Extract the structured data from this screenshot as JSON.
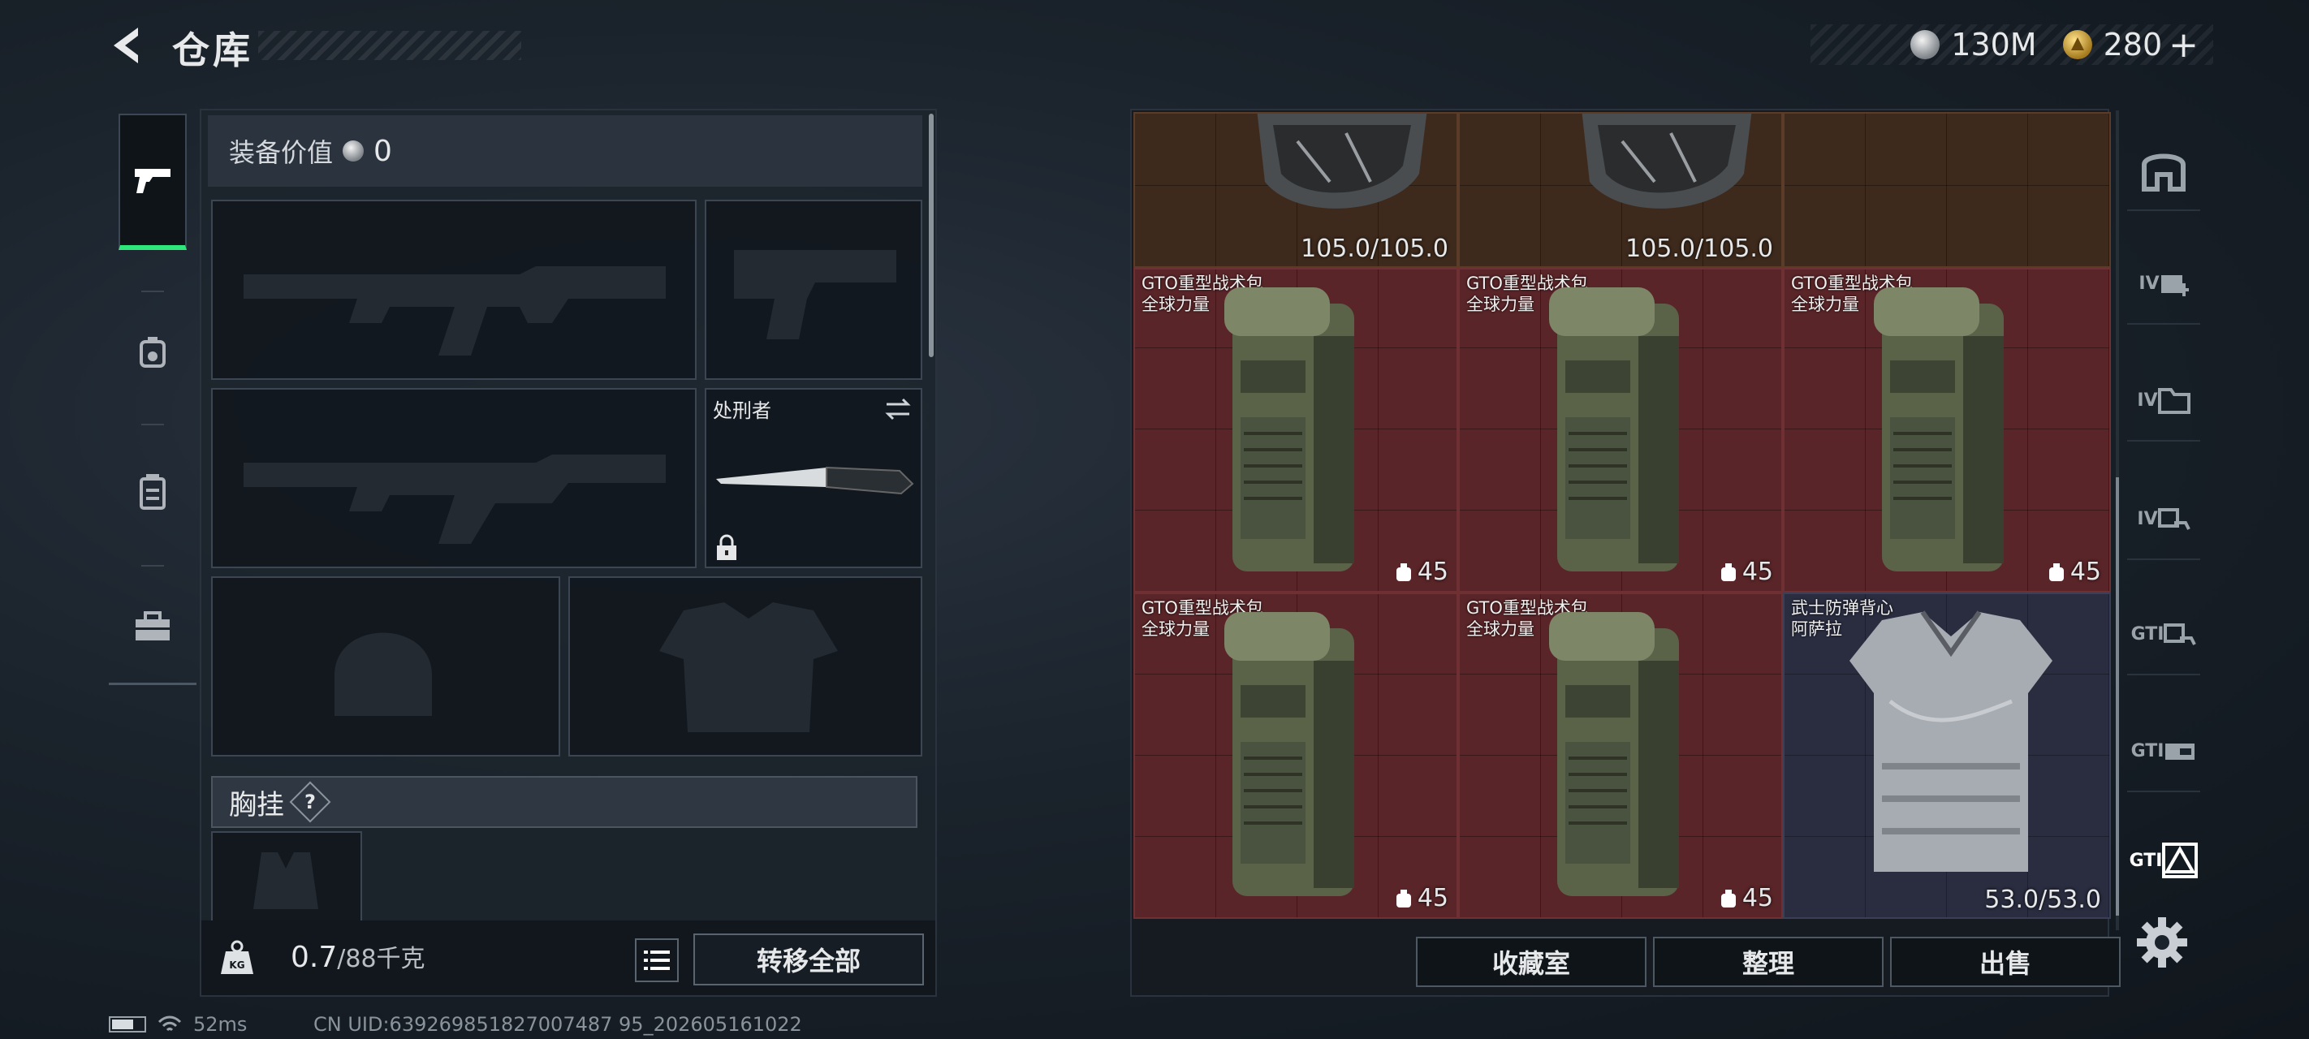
{
  "header": {
    "title": "仓库",
    "currency_silver": "130M",
    "currency_gold": "280",
    "plus_label": "+"
  },
  "left_nav": {
    "items": [
      {
        "name": "weapons-tab",
        "icon": "pistol-icon",
        "active": true
      },
      {
        "name": "gear-tab",
        "icon": "helmet-bag-icon",
        "active": false
      },
      {
        "name": "backpack-tab",
        "icon": "backpack-icon",
        "active": false
      },
      {
        "name": "toolbox-tab",
        "icon": "toolbox-icon",
        "active": false
      }
    ]
  },
  "loadout": {
    "equipment_value_label": "装备价值",
    "equipment_value": "0",
    "knife_name": "处刑者",
    "chest_rig_label": "胸挂",
    "chest_rig_hint": "?",
    "weight_current": "0.7",
    "weight_max": "/88千克",
    "transfer_all_label": "转移全部"
  },
  "storage": {
    "top_items": [
      {
        "durability": "105.0/105.0"
      },
      {
        "durability": "105.0/105.0"
      }
    ],
    "items": [
      {
        "name": "GTO重型战术包",
        "brand": "全球力量",
        "capacity": "45"
      },
      {
        "name": "GTO重型战术包",
        "brand": "全球力量",
        "capacity": "45"
      },
      {
        "name": "GTO重型战术包",
        "brand": "全球力量",
        "capacity": "45"
      },
      {
        "name": "GTO重型战术包",
        "brand": "全球力量",
        "capacity": "45"
      },
      {
        "name": "GTO重型战术包",
        "brand": "全球力量",
        "capacity": "45"
      },
      {
        "name": "武士防弹背心",
        "brand": "阿萨拉",
        "durability": "53.0/53.0"
      }
    ],
    "buttons": {
      "collection": "收藏室",
      "sort": "整理",
      "sell": "出售"
    }
  },
  "right_rail": {
    "items": [
      "",
      "IV",
      "IV",
      "IV",
      "GTI",
      "GTI",
      "GTI"
    ]
  },
  "status_bar": {
    "ping": "52ms",
    "uid": "CN UID:639269851827007487 95_202605161022"
  },
  "colors": {
    "accent_green": "#2ee67a",
    "cell_red": "#5a2528",
    "cell_navy": "#2a2d40",
    "cell_brown": "#3e2a1c"
  }
}
